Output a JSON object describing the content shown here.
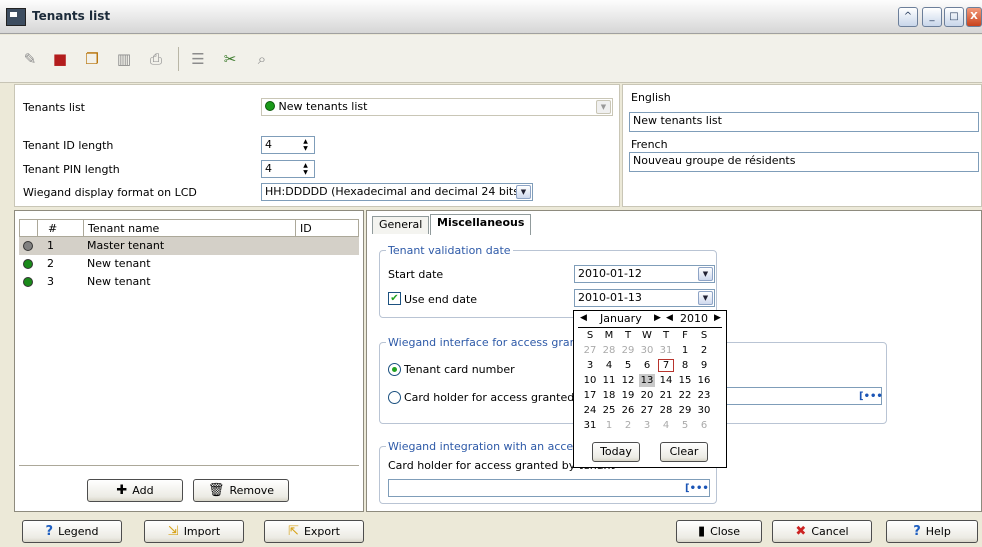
{
  "window": {
    "title": "Tenants list",
    "controls": [
      "^",
      "_",
      "□",
      "X"
    ]
  },
  "toolbar": {
    "icons": [
      "new-icon",
      "save-icon",
      "copy-icon",
      "delete-icon",
      "print-icon",
      "list-icon",
      "tools-icon",
      "find-icon"
    ]
  },
  "properties": {
    "tenants_list_label": "Tenants list",
    "tenants_list_value": "New tenants list",
    "tenant_id_length_label": "Tenant ID length",
    "tenant_id_length_value": "4",
    "tenant_pin_length_label": "Tenant PIN length",
    "tenant_pin_length_value": "4",
    "wiegand_label": "Wiegand display format on LCD",
    "wiegand_value": "HH:DDDDD (Hexadecimal and decimal 24 bits)"
  },
  "languages": {
    "english_label": "English",
    "english_value": "New tenants list",
    "french_label": "French",
    "french_value": "Nouveau groupe de résidents"
  },
  "tenant_list": {
    "columns": [
      "#",
      "Tenant name",
      "ID"
    ],
    "rows": [
      {
        "num": "1",
        "name": "Master tenant",
        "id": "",
        "status_color": "#808080"
      },
      {
        "num": "2",
        "name": "New tenant",
        "id": "",
        "status_color": "#1a8a1a"
      },
      {
        "num": "3",
        "name": "New tenant",
        "id": "",
        "status_color": "#1a8a1a"
      }
    ],
    "add_label": "Add",
    "remove_label": "Remove"
  },
  "tabs": {
    "general": "General",
    "misc": "Miscellaneous"
  },
  "misc": {
    "validation_title": "Tenant validation date",
    "start_date_label": "Start date",
    "start_date_value": "2010-01-12",
    "use_end_date_label": "Use end date",
    "end_date_value": "2010-01-13",
    "wiegand_interface_title": "Wiegand interface for access granted",
    "radio_card_number": "Tenant card number",
    "radio_card_holder": "Card holder for access granted",
    "integration_title": "Wiegand integration with an access cor",
    "card_holder_by_tenant": "Card holder for access granted by tenant"
  },
  "calendar": {
    "month": "January",
    "year": "2010",
    "weekdays": [
      "S",
      "M",
      "T",
      "W",
      "T",
      "F",
      "S"
    ],
    "days": [
      [
        "27",
        "28",
        "29",
        "30",
        "31",
        "1",
        "2"
      ],
      [
        "3",
        "4",
        "5",
        "6",
        "7",
        "8",
        "9"
      ],
      [
        "10",
        "11",
        "12",
        "13",
        "14",
        "15",
        "16"
      ],
      [
        "17",
        "18",
        "19",
        "20",
        "21",
        "22",
        "23"
      ],
      [
        "24",
        "25",
        "26",
        "27",
        "28",
        "29",
        "30"
      ],
      [
        "31",
        "1",
        "2",
        "3",
        "4",
        "5",
        "6"
      ]
    ],
    "today_label": "Today",
    "clear_label": "Clear"
  },
  "bottom": {
    "legend": "Legend",
    "import": "Import",
    "export": "Export",
    "close": "Close",
    "cancel": "Cancel",
    "help": "Help"
  }
}
